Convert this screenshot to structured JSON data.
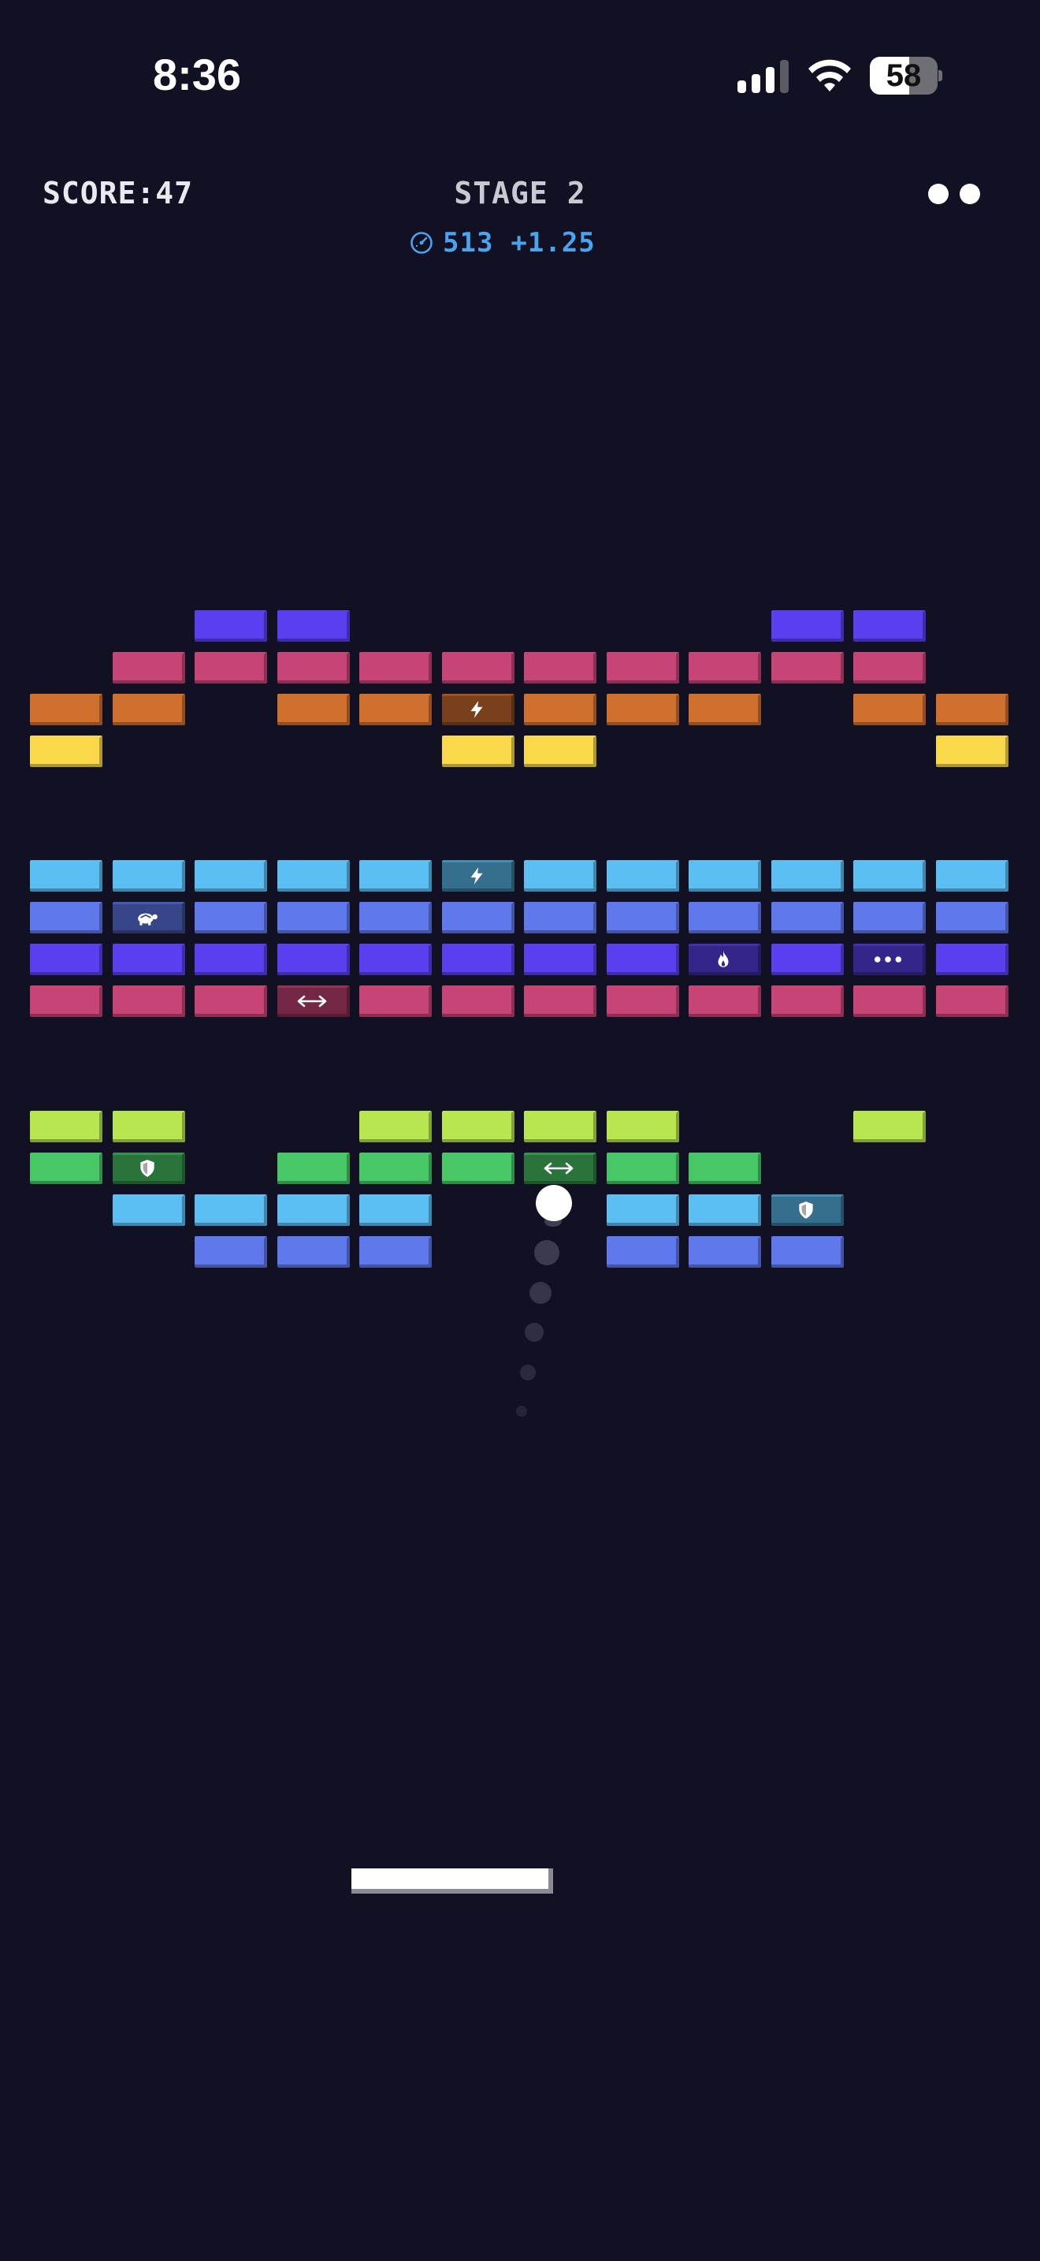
{
  "status_bar": {
    "time": "8:36",
    "battery_level": "58",
    "signal_bars": 3,
    "icons": [
      "cellular-signal-icon",
      "wifi-icon",
      "battery-icon"
    ]
  },
  "hud": {
    "score_label": "SCORE:47",
    "stage_label": "STAGE 2",
    "lives": 2,
    "speed_value": "513",
    "speed_multiplier": "+1.25",
    "speed_icon": "speedometer-icon"
  },
  "colors": {
    "background": "#121124",
    "violet": "#5a3ff0",
    "pink": "#c74476",
    "orange": "#d0702e",
    "yellow": "#f9d94a",
    "cyan": "#5bbff3",
    "blue": "#5f78ec",
    "lime": "#b7e64f",
    "green": "#48c766",
    "hud_accent": "#4aa3ef"
  },
  "legend": {
    "V": "violet",
    "P": "pink",
    "O": "orange",
    "Y": "yellow",
    "C": "cyan",
    "B": "blue",
    "L": "lime",
    "G": "green"
  },
  "bricks": [
    "..VV.....VV..",
    ".PPPPPPPPPP..",
    "OO.OO[O:lightning]OOO.OO",
    "Y....YY....Y.",
    "",
    "",
    "CCCCC[C:lightning]CCCCCC",
    "B[B:turtle]BBBBBBBBBB",
    "VVVVVVVV[V:flame]V[V:dots]V",
    "PPP[P:expand]PPPPPPPP",
    "",
    "",
    "LL..LLLL..L.",
    "G[G:shield].GGG[G:expand]GG...",
    ".CCCC..CC[C:shield]...",
    "..BBB..BBB...."
  ],
  "powerup_icons": {
    "lightning": "lightning-icon",
    "turtle": "turtle-icon",
    "flame": "flame-icon",
    "dots": "multiball-icon",
    "expand": "expand-paddle-icon",
    "shield": "shield-icon"
  }
}
